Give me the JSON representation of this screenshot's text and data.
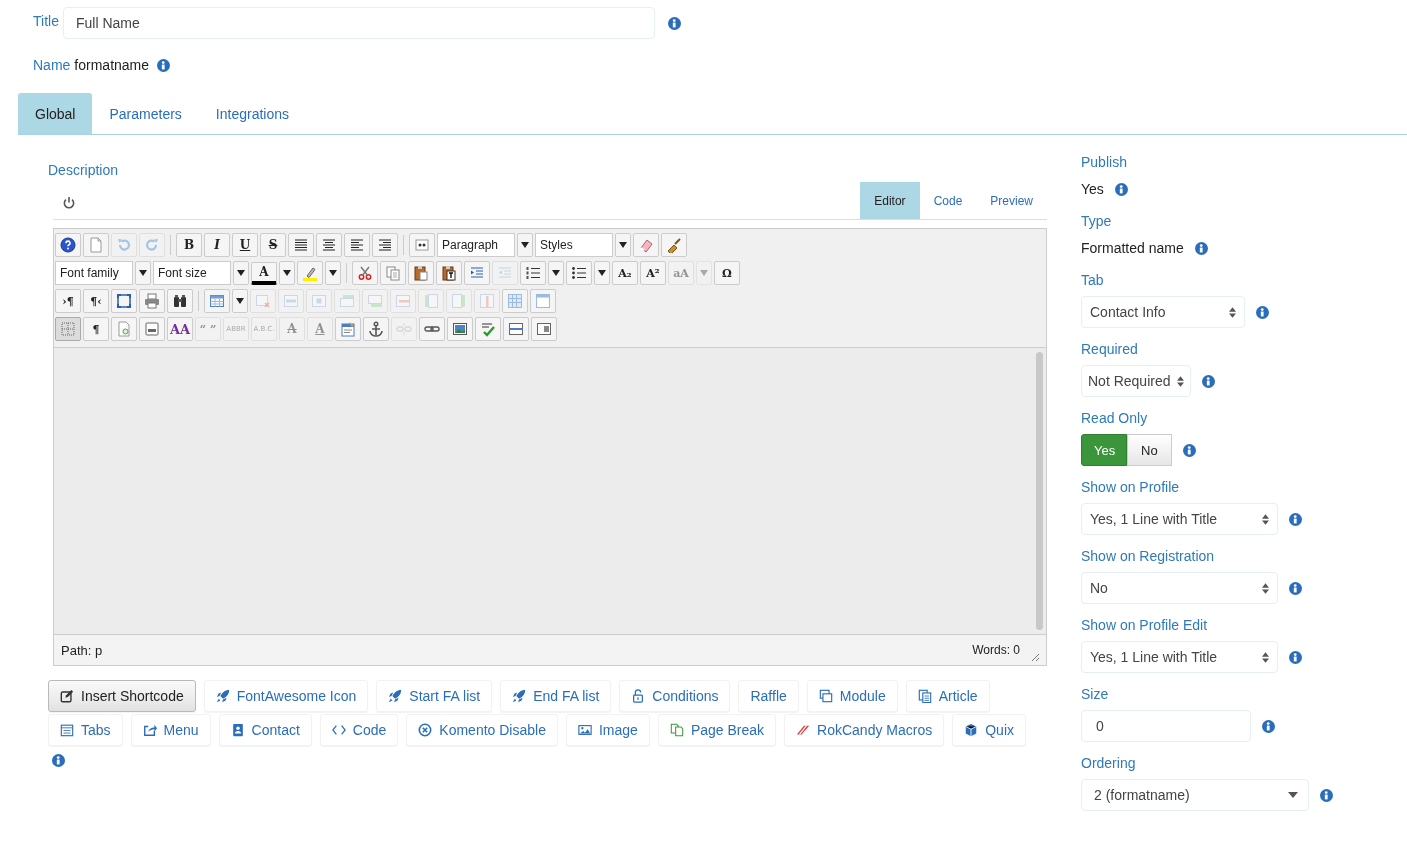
{
  "title_field": {
    "label": "Title",
    "value": "Full Name"
  },
  "name_field": {
    "label": "Name",
    "value": "formatname"
  },
  "tabs": [
    {
      "label": "Global",
      "selected": true
    },
    {
      "label": "Parameters",
      "selected": false
    },
    {
      "label": "Integrations",
      "selected": false
    }
  ],
  "description": {
    "label": "Description",
    "editor_tabs": [
      {
        "label": "Editor",
        "selected": true
      },
      {
        "label": "Code",
        "selected": false
      },
      {
        "label": "Preview",
        "selected": false
      }
    ],
    "toolbar": [
      {
        "groups": [
          [
            {
              "kind": "icon",
              "disabled": false,
              "active": false
            },
            {
              "kind": "icon",
              "disabled": false,
              "active": false
            },
            {
              "kind": "icon",
              "disabled": true,
              "active": false
            },
            {
              "kind": "icon",
              "disabled": true,
              "active": false
            }
          ],
          [
            {
              "kind": "bold",
              "glyph": "B",
              "disabled": false,
              "active": false
            },
            {
              "kind": "italic",
              "glyph": "I",
              "disabled": false,
              "active": false
            },
            {
              "kind": "underline",
              "glyph": "U",
              "disabled": false,
              "active": false
            },
            {
              "kind": "strike",
              "glyph": "S",
              "disabled": false,
              "active": false
            },
            {
              "kind": "icon",
              "disabled": false,
              "active": false
            },
            {
              "kind": "icon",
              "disabled": false,
              "active": false
            },
            {
              "kind": "icon",
              "disabled": false,
              "active": false
            },
            {
              "kind": "icon",
              "disabled": false,
              "active": false
            }
          ],
          [
            {
              "kind": "icon",
              "disabled": false,
              "active": false
            },
            {
              "kind": "select",
              "value": "Paragraph"
            },
            {
              "kind": "caret",
              "disabled": false
            },
            {
              "kind": "select",
              "value": "Styles"
            },
            {
              "kind": "caret",
              "disabled": false
            },
            {
              "kind": "icon",
              "disabled": false,
              "active": false
            },
            {
              "kind": "icon",
              "disabled": false,
              "active": false
            }
          ]
        ]
      },
      {
        "groups": [
          [
            {
              "kind": "select",
              "value": "Font family"
            },
            {
              "kind": "caret",
              "disabled": false
            },
            {
              "kind": "select",
              "value": "Font size"
            },
            {
              "kind": "caret",
              "disabled": false
            },
            {
              "kind": "forecolor",
              "glyph": "A",
              "disabled": false,
              "active": false
            },
            {
              "kind": "caret",
              "disabled": false
            },
            {
              "kind": "icon",
              "disabled": false,
              "active": false
            },
            {
              "kind": "caret",
              "disabled": false
            }
          ],
          [
            {
              "kind": "icon",
              "disabled": false,
              "active": false
            },
            {
              "kind": "icon",
              "disabled": false,
              "active": false
            },
            {
              "kind": "icon",
              "disabled": false,
              "active": false
            },
            {
              "kind": "icon",
              "disabled": false,
              "active": false
            },
            {
              "kind": "icon",
              "disabled": false,
              "active": false
            },
            {
              "kind": "icon",
              "disabled": true,
              "active": false
            },
            {
              "kind": "icon",
              "disabled": false,
              "active": false
            },
            {
              "kind": "caret",
              "disabled": false
            },
            {
              "kind": "icon",
              "disabled": false,
              "active": false
            },
            {
              "kind": "caret",
              "disabled": false
            },
            {
              "kind": "glyph",
              "glyph": "A₂",
              "disabled": false,
              "active": false
            },
            {
              "kind": "glyph",
              "glyph": "A²",
              "disabled": false,
              "active": false
            },
            {
              "kind": "glyph",
              "glyph": "aA",
              "disabled": true,
              "active": false
            },
            {
              "kind": "caret",
              "disabled": true
            },
            {
              "kind": "glyph",
              "glyph": "Ω",
              "disabled": false,
              "active": false
            }
          ]
        ]
      },
      {
        "groups": [
          [
            {
              "kind": "glyph",
              "glyph": "›¶",
              "disabled": false,
              "active": false
            },
            {
              "kind": "glyph",
              "glyph": "¶‹",
              "disabled": false,
              "active": false
            },
            {
              "kind": "icon",
              "disabled": false,
              "active": false
            },
            {
              "kind": "icon",
              "disabled": false,
              "active": false
            },
            {
              "kind": "icon",
              "disabled": false,
              "active": false
            }
          ],
          [
            {
              "kind": "icon",
              "disabled": false,
              "active": false
            },
            {
              "kind": "caret",
              "disabled": false
            },
            {
              "kind": "icon",
              "disabled": true,
              "active": false
            },
            {
              "kind": "icon",
              "disabled": true,
              "active": false
            },
            {
              "kind": "icon",
              "disabled": true,
              "active": false
            },
            {
              "kind": "icon",
              "disabled": true,
              "active": false
            },
            {
              "kind": "icon",
              "disabled": true,
              "active": false
            },
            {
              "kind": "icon",
              "disabled": true,
              "active": false
            },
            {
              "kind": "icon",
              "disabled": true,
              "active": false
            },
            {
              "kind": "icon",
              "disabled": true,
              "active": false
            },
            {
              "kind": "icon",
              "disabled": true,
              "active": false
            },
            {
              "kind": "icon",
              "disabled": false,
              "active": false
            },
            {
              "kind": "icon",
              "disabled": false,
              "active": false
            }
          ]
        ]
      },
      {
        "groups": [
          [
            {
              "kind": "icon",
              "disabled": false,
              "active": true
            },
            {
              "kind": "glyph",
              "glyph": "¶",
              "disabled": false,
              "active": false
            },
            {
              "kind": "icon",
              "disabled": false,
              "active": false
            },
            {
              "kind": "icon",
              "disabled": false,
              "active": false
            },
            {
              "kind": "styles",
              "glyph": "AA",
              "disabled": false,
              "active": false
            },
            {
              "kind": "glyph",
              "glyph": "“ ”",
              "disabled": true,
              "active": false
            },
            {
              "kind": "tiny",
              "glyph": "ABBR",
              "disabled": true,
              "active": false
            },
            {
              "kind": "tiny",
              "glyph": "A.B.C.",
              "disabled": true,
              "active": false
            },
            {
              "kind": "strike",
              "glyph": "A",
              "disabled": true,
              "active": false
            },
            {
              "kind": "underline",
              "glyph": "A",
              "disabled": true,
              "active": false
            },
            {
              "kind": "icon",
              "disabled": false,
              "active": false
            },
            {
              "kind": "icon",
              "disabled": false,
              "active": false
            },
            {
              "kind": "icon",
              "disabled": true,
              "active": false
            },
            {
              "kind": "icon",
              "disabled": false,
              "active": false
            },
            {
              "kind": "icon",
              "disabled": false,
              "active": false
            },
            {
              "kind": "icon",
              "disabled": false,
              "active": false
            },
            {
              "kind": "icon",
              "disabled": false,
              "active": false
            },
            {
              "kind": "icon",
              "disabled": false,
              "active": false
            }
          ]
        ]
      }
    ],
    "path_label": "Path:",
    "path_value": "p",
    "words": "Words: 0"
  },
  "shortcode_buttons": [
    {
      "label": "Insert Shortcode",
      "kind": "primary"
    },
    {
      "label": "FontAwesome Icon",
      "kind": "link"
    },
    {
      "label": "Start FA list",
      "kind": "link"
    },
    {
      "label": "End FA list",
      "kind": "link"
    },
    {
      "label": "Conditions",
      "kind": "link"
    },
    {
      "label": "Raffle",
      "kind": "link"
    },
    {
      "label": "Module",
      "kind": "link"
    },
    {
      "label": "Article",
      "kind": "link"
    },
    {
      "label": "Tabs",
      "kind": "link"
    },
    {
      "label": "Menu",
      "kind": "link"
    },
    {
      "label": "Contact",
      "kind": "link"
    },
    {
      "label": "Code",
      "kind": "link"
    },
    {
      "label": "Komento Disable",
      "kind": "link"
    },
    {
      "label": "Image",
      "kind": "link"
    },
    {
      "label": "Page Break",
      "kind": "link"
    },
    {
      "label": "RokCandy Macros",
      "kind": "link"
    },
    {
      "label": "Quix",
      "kind": "link"
    }
  ],
  "settings": [
    {
      "label": "Publish",
      "kind": "text",
      "value": "Yes"
    },
    {
      "label": "Type",
      "kind": "text",
      "value": "Formatted name"
    },
    {
      "label": "Tab",
      "kind": "select",
      "value": "Contact Info"
    },
    {
      "label": "Required",
      "kind": "select",
      "value": "Not Required"
    },
    {
      "label": "Read Only",
      "kind": "toggle",
      "options": [
        {
          "label": "Yes",
          "selected": true
        },
        {
          "label": "No",
          "selected": false
        }
      ]
    },
    {
      "label": "Show on Profile",
      "kind": "select",
      "value": "Yes, 1 Line with Title"
    },
    {
      "label": "Show on Registration",
      "kind": "select",
      "value": "No"
    },
    {
      "label": "Show on Profile Edit",
      "kind": "select",
      "value": "Yes, 1 Line with Title"
    },
    {
      "label": "Size",
      "kind": "input",
      "value": "0"
    },
    {
      "label": "Ordering",
      "kind": "dropdown",
      "value": "2 (formatname)"
    }
  ]
}
